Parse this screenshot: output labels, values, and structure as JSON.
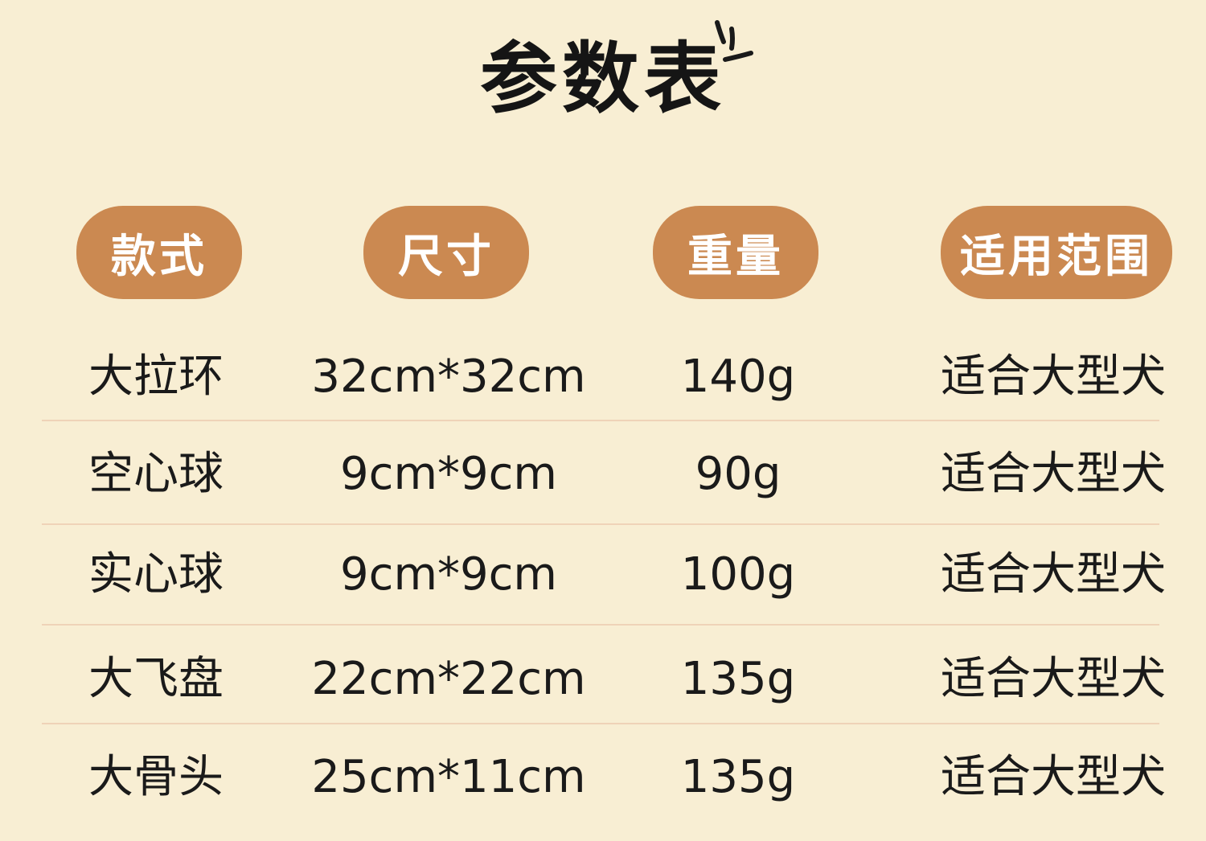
{
  "title": "参数表",
  "headers": [
    "款式",
    "尺寸",
    "重量",
    "适用范围"
  ],
  "rows": [
    {
      "style": "大拉环",
      "size": "32cm*32cm",
      "weight": "140g",
      "range": "适合大型犬"
    },
    {
      "style": "空心球",
      "size": "9cm*9cm",
      "weight": "90g",
      "range": "适合大型犬"
    },
    {
      "style": "实心球",
      "size": "9cm*9cm",
      "weight": "100g",
      "range": "适合大型犬"
    },
    {
      "style": "大飞盘",
      "size": "22cm*22cm",
      "weight": "135g",
      "range": "适合大型犬"
    },
    {
      "style": "大骨头",
      "size": "25cm*11cm",
      "weight": "135g",
      "range": "适合大型犬"
    }
  ],
  "colors": {
    "background": "#f8eed3",
    "header_pill": "#cb8951",
    "header_text": "#ffffff",
    "divider": "#efd3b8"
  },
  "icons": [
    "sparkle-icon"
  ]
}
